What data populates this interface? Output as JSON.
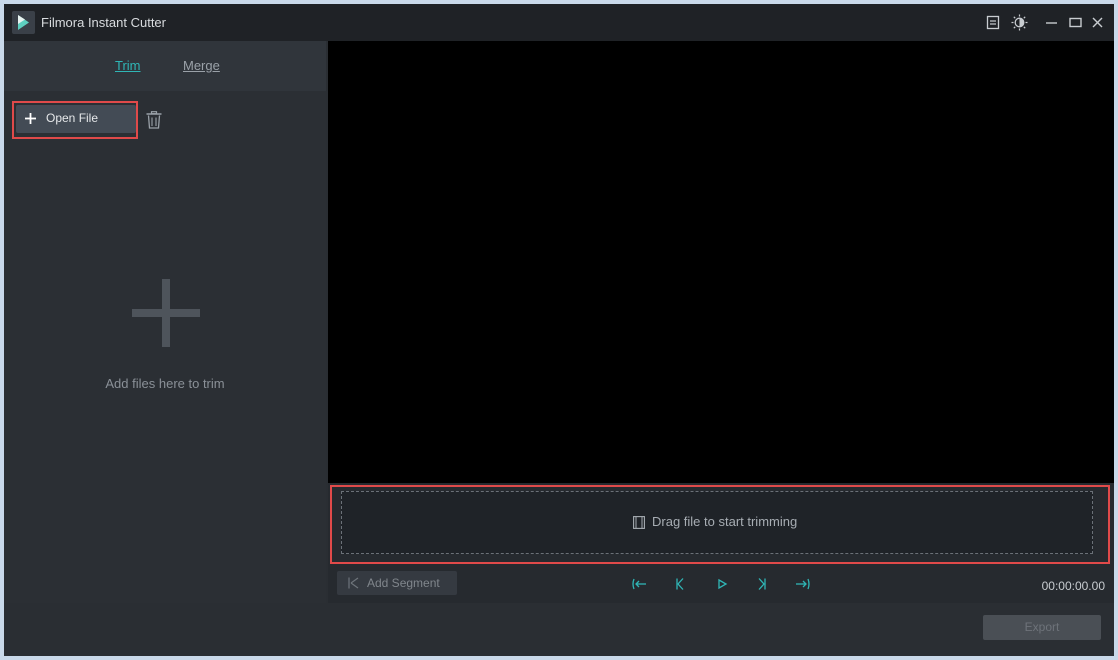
{
  "window": {
    "title": "Filmora Instant Cutter"
  },
  "tabs": [
    {
      "label": "Trim",
      "active": true
    },
    {
      "label": "Merge",
      "active": false
    }
  ],
  "toolbar": {
    "open_file_label": "Open File"
  },
  "left_panel": {
    "empty_message": "Add files here to trim"
  },
  "drop_zone": {
    "text": "Drag file to start trimming"
  },
  "controls": {
    "add_segment_label": "Add Segment",
    "timecode": "00:00:00.00"
  },
  "footer": {
    "export_label": "Export"
  },
  "icons": [
    "filmora-logo-icon",
    "menu-icon",
    "theme-toggle-icon",
    "minimize-icon",
    "maximize-icon",
    "close-icon",
    "plus-icon",
    "trash-icon",
    "film-icon",
    "scissors-icon",
    "go-to-start-icon",
    "previous-frame-icon",
    "play-icon",
    "next-frame-icon",
    "go-to-end-icon"
  ],
  "colors": {
    "accent": "#2fb6b6",
    "highlight": "#e04a4a",
    "titlebar": "#1f2226",
    "panel": "#2b2f34",
    "preview": "#000000"
  }
}
